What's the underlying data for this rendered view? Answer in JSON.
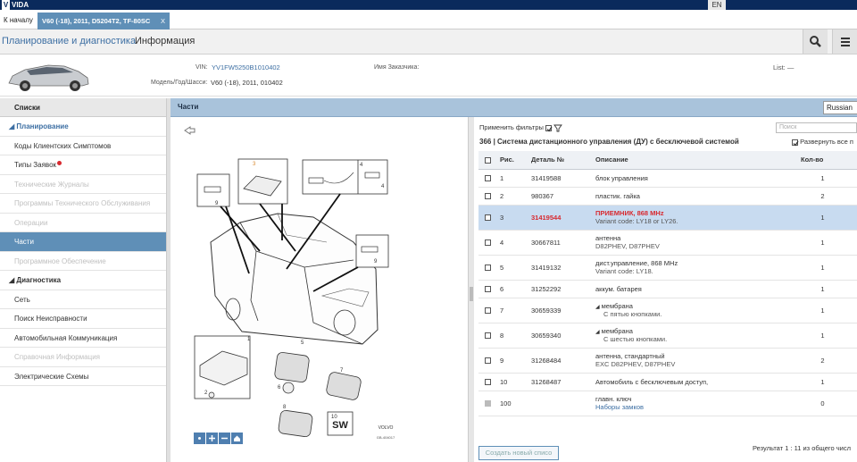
{
  "topbar": {
    "app_name": "VIDA",
    "lang": "EN"
  },
  "tabs": {
    "home": "К началу",
    "vehicle": "V60 (-18), 2011, D5204T2, TF-80SC",
    "close": "X"
  },
  "nav": {
    "planning": "Планирование и диагностика",
    "info": "Информация"
  },
  "vehicle": {
    "vin_label": "VIN:",
    "vin": "YV1FW5250B1010402",
    "model_label": "Модель/Год/Шасси:",
    "model": "V60 (-18), 2011, 010402",
    "customer_label": "Имя Заказчика:",
    "list_label": "List: —"
  },
  "sidebar": {
    "title": "Списки",
    "items": [
      {
        "label": "◢ Планирование",
        "kind": "section-blue"
      },
      {
        "label": "Коды Клиентских Симптомов",
        "kind": "normal"
      },
      {
        "label": "Типы Заявок",
        "kind": "badge"
      },
      {
        "label": "Технические Журналы",
        "kind": "disabled"
      },
      {
        "label": "Программы Технического Обслуживания",
        "kind": "disabled"
      },
      {
        "label": "Операции",
        "kind": "disabled"
      },
      {
        "label": "Части",
        "kind": "active"
      },
      {
        "label": "Программное Обеспечение",
        "kind": "disabled"
      },
      {
        "label": "◢ Диагностика",
        "kind": "section"
      },
      {
        "label": "Сеть",
        "kind": "normal"
      },
      {
        "label": "Поиск Неисправности",
        "kind": "normal"
      },
      {
        "label": "Автомобильная Коммуникация",
        "kind": "normal"
      },
      {
        "label": "Справочная Информация",
        "kind": "disabled"
      },
      {
        "label": "Электрические Схемы",
        "kind": "normal"
      }
    ]
  },
  "parts": {
    "title": "Части",
    "language": "Russian",
    "apply_filters": "Применить фильтры",
    "search_placeholder": "Поиск",
    "group_title": "366  |  Система дистанционного управления (ДУ) с бесключевой системой",
    "expand_all": "Развернуть все п",
    "columns": {
      "fig": "Рис.",
      "part": "Деталь №",
      "desc": "Описание",
      "qty": "Кол-во"
    },
    "rows": [
      {
        "fig": "1",
        "part": "31419588",
        "desc": "блок управления",
        "sub": "",
        "qty": "1"
      },
      {
        "fig": "2",
        "part": "980367",
        "desc": "пластик. гайка",
        "sub": "",
        "qty": "2"
      },
      {
        "fig": "3",
        "part": "31419544",
        "desc": "ПРИЕМНИК, 868 MHz",
        "sub": "Variant code: LY18 or LY26.",
        "qty": "1",
        "selected": true
      },
      {
        "fig": "4",
        "part": "30667811",
        "desc": "антенна",
        "sub": "D82PHEV, D87PHEV",
        "qty": "1"
      },
      {
        "fig": "5",
        "part": "31419132",
        "desc": "дист.управление, 868 MHz",
        "sub": "Variant code: LY18.",
        "qty": "1"
      },
      {
        "fig": "6",
        "part": "31252292",
        "desc": "аккум. батарея",
        "sub": "",
        "qty": "1"
      },
      {
        "fig": "7",
        "part": "30659339",
        "desc": "мембрана",
        "sub": "С пятью кнопками.",
        "qty": "1",
        "tri": true
      },
      {
        "fig": "8",
        "part": "30659340",
        "desc": "мембрана",
        "sub": "С шестью кнопками.",
        "qty": "1",
        "tri": true
      },
      {
        "fig": "9",
        "part": "31268484",
        "desc": "антенна, стандартный",
        "sub": "EXC D82PHEV, D87PHEV",
        "qty": "2"
      },
      {
        "fig": "10",
        "part": "31268487",
        "desc": "Автомобиль с бесключевым доступ,",
        "sub": "",
        "qty": "1"
      },
      {
        "fig": "100",
        "part": "",
        "desc": "главн. ключ",
        "sub": "Наборы замков",
        "qty": "0",
        "sublink": true,
        "greychk": true
      }
    ],
    "create_button": "Создать новый списо",
    "result": "Результат 1 : 11 из общего числ"
  },
  "diagram": {
    "labels": [
      "1",
      "2",
      "3",
      "4",
      "4",
      "5",
      "6",
      "7",
      "8",
      "9",
      "9",
      "10"
    ],
    "sw": "SW",
    "brand": "VOLVO",
    "code": "GB-404017"
  }
}
